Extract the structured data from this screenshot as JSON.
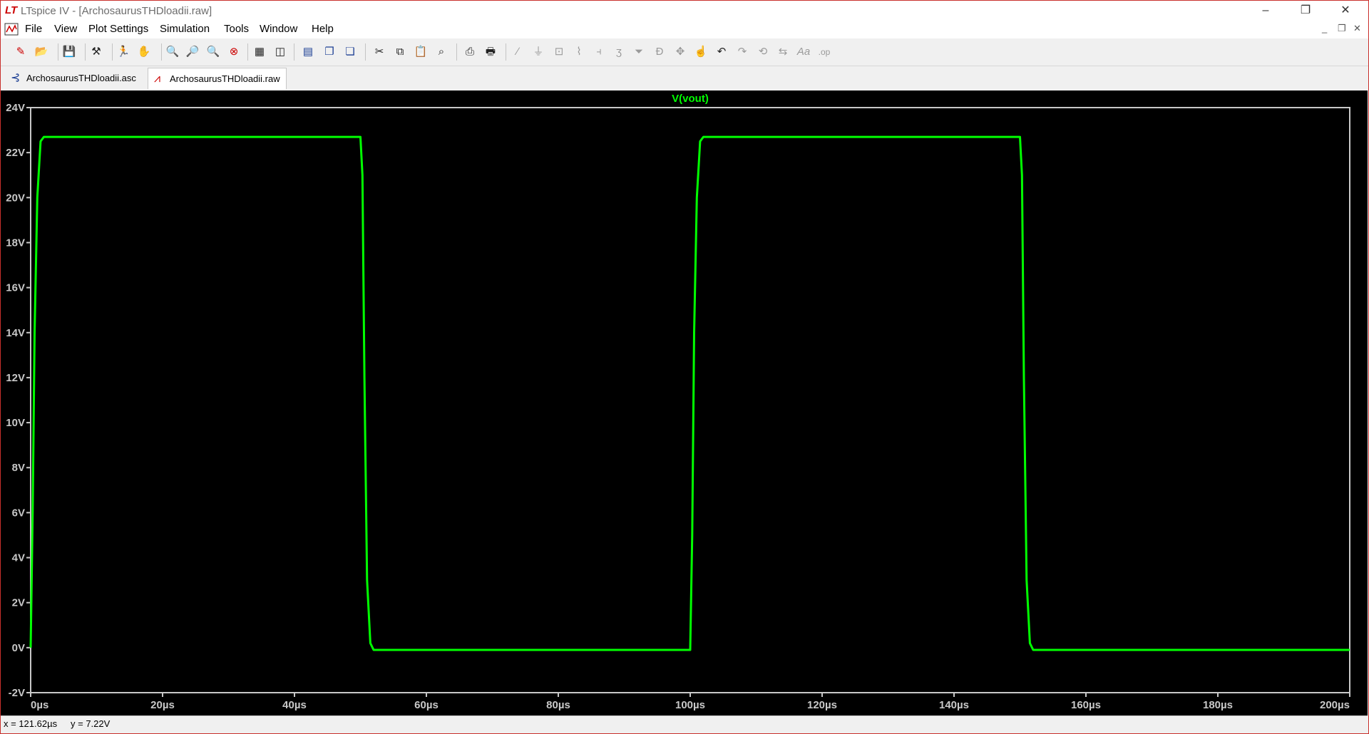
{
  "window": {
    "title": "LTspice IV - [ArchosaurusTHDloadii.raw]",
    "app_icon": "LT",
    "minimize": "–",
    "restore": "❐",
    "close": "✕"
  },
  "menu": {
    "items": [
      "File",
      "View",
      "Plot Settings",
      "Simulation",
      "Tools",
      "Window",
      "Help"
    ],
    "mdi_minimize": "_",
    "mdi_restore": "❐",
    "mdi_close": "✕"
  },
  "toolbar": {
    "icons": [
      "new-schematic-icon",
      "open-icon",
      "save-icon",
      "control-panel-icon",
      "run-icon",
      "halt-icon",
      "zoom-in-icon",
      "zoom-full-icon",
      "zoom-out-icon",
      "zoom-cancel-icon",
      "autorange-icon",
      "pick-visible-traces-icon",
      "tile-horizontal-icon",
      "cascade-icon",
      "tile-vertical-icon",
      "cut-icon",
      "copy-icon",
      "paste-icon",
      "find-icon",
      "print-preview-icon",
      "print-icon",
      "wire-icon",
      "ground-icon",
      "label-net-icon",
      "resistor-icon",
      "capacitor-icon",
      "inductor-icon",
      "diode-icon",
      "component-icon",
      "move-icon",
      "drag-icon",
      "undo-icon",
      "redo-icon",
      "rotate-icon",
      "mirror-icon",
      "text-icon",
      "spice-directive-icon"
    ]
  },
  "tabs": [
    {
      "label": "ArchosaurusTHDloadii.asc",
      "icon": "schematic-icon"
    },
    {
      "label": "ArchosaurusTHDloadii.raw",
      "icon": "waveform-icon"
    }
  ],
  "status": {
    "x_readout": "x = 121.62µs",
    "y_readout": "y = 7.22V"
  },
  "chart_data": {
    "type": "line",
    "title": "V(vout)",
    "xlabel": "",
    "ylabel": "",
    "x_unit": "µs",
    "y_unit": "V",
    "xlim": [
      0,
      200
    ],
    "ylim": [
      -2,
      24
    ],
    "x_ticks": [
      "0µs",
      "20µs",
      "40µs",
      "60µs",
      "80µs",
      "100µs",
      "120µs",
      "140µs",
      "160µs",
      "180µs",
      "200µs"
    ],
    "x_tick_values": [
      0,
      20,
      40,
      60,
      80,
      100,
      120,
      140,
      160,
      180,
      200
    ],
    "y_ticks": [
      "24V",
      "22V",
      "20V",
      "18V",
      "16V",
      "14V",
      "12V",
      "10V",
      "8V",
      "6V",
      "4V",
      "2V",
      "0V",
      "-2V"
    ],
    "y_tick_values": [
      24,
      22,
      20,
      18,
      16,
      14,
      12,
      10,
      8,
      6,
      4,
      2,
      0,
      -2
    ],
    "series": [
      {
        "name": "V(vout)",
        "color": "#00ff00",
        "x": [
          0,
          0.3,
          0.6,
          1.0,
          1.5,
          2.0,
          50.0,
          50.3,
          50.6,
          51.0,
          51.5,
          52.0,
          100.0,
          100.3,
          100.6,
          101.0,
          101.5,
          102.0,
          150.0,
          150.3,
          150.6,
          151.0,
          151.5,
          152.0,
          200.0
        ],
        "y": [
          0,
          6,
          14,
          20,
          22.5,
          22.7,
          22.7,
          21,
          12,
          3,
          0.2,
          -0.1,
          -0.1,
          5,
          14,
          20,
          22.5,
          22.7,
          22.7,
          21,
          12,
          3,
          0.2,
          -0.1,
          -0.1
        ]
      }
    ],
    "background": "#000000",
    "axis_color": "#c8c8c8",
    "title_color": "#00ff00"
  }
}
